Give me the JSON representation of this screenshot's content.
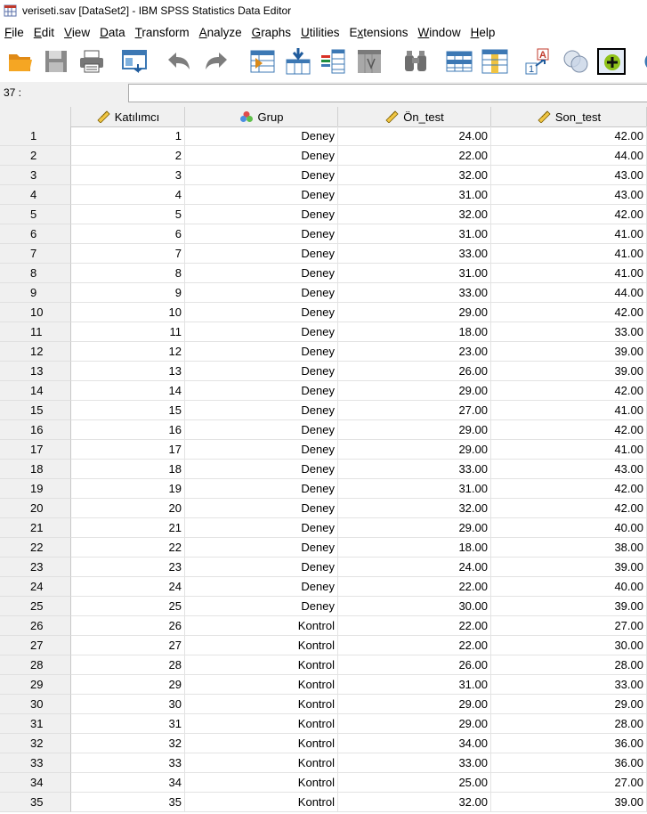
{
  "window": {
    "title": "veriseti.sav [DataSet2] - IBM SPSS Statistics Data Editor"
  },
  "menu": [
    {
      "label": "File",
      "ul": "F",
      "rest": "ile"
    },
    {
      "label": "Edit",
      "ul": "E",
      "rest": "dit"
    },
    {
      "label": "View",
      "ul": "V",
      "rest": "iew"
    },
    {
      "label": "Data",
      "ul": "D",
      "rest": "ata"
    },
    {
      "label": "Transform",
      "ul": "T",
      "rest": "ransform"
    },
    {
      "label": "Analyze",
      "ul": "A",
      "rest": "nalyze"
    },
    {
      "label": "Graphs",
      "ul": "G",
      "rest": "raphs"
    },
    {
      "label": "Utilities",
      "ul": "U",
      "rest": "tilities"
    },
    {
      "label": "Extensions",
      "ul": "x",
      "pre": "E",
      "rest": "tensions"
    },
    {
      "label": "Window",
      "ul": "W",
      "rest": "indow"
    },
    {
      "label": "Help",
      "ul": "H",
      "rest": "elp"
    }
  ],
  "toolbar": {
    "icons": [
      "open-folder-icon",
      "save-icon",
      "print-icon",
      "recall-dialog-icon",
      "undo-icon",
      "redo-icon",
      "goto-case-icon",
      "goto-variable-icon",
      "variables-icon",
      "run-descriptives-icon",
      "find-icon",
      "insert-cases-icon",
      "insert-variable-icon",
      "split-file-icon",
      "weight-cases-icon",
      "select-cases-icon",
      "value-labels-icon",
      "use-sets-icon"
    ]
  },
  "cellbar": {
    "ref": "37 :",
    "value": ""
  },
  "columns": [
    {
      "name": "Katılımcı",
      "icon": "scale-ruler-icon"
    },
    {
      "name": "Grup",
      "icon": "nominal-circles-icon"
    },
    {
      "name": "Ön_test",
      "icon": "scale-ruler-icon"
    },
    {
      "name": "Son_test",
      "icon": "scale-ruler-icon"
    }
  ],
  "rows": [
    [
      "1",
      "1",
      "Deney",
      "24.00",
      "42.00"
    ],
    [
      "2",
      "2",
      "Deney",
      "22.00",
      "44.00"
    ],
    [
      "3",
      "3",
      "Deney",
      "32.00",
      "43.00"
    ],
    [
      "4",
      "4",
      "Deney",
      "31.00",
      "43.00"
    ],
    [
      "5",
      "5",
      "Deney",
      "32.00",
      "42.00"
    ],
    [
      "6",
      "6",
      "Deney",
      "31.00",
      "41.00"
    ],
    [
      "7",
      "7",
      "Deney",
      "33.00",
      "41.00"
    ],
    [
      "8",
      "8",
      "Deney",
      "31.00",
      "41.00"
    ],
    [
      "9",
      "9",
      "Deney",
      "33.00",
      "44.00"
    ],
    [
      "10",
      "10",
      "Deney",
      "29.00",
      "42.00"
    ],
    [
      "11",
      "11",
      "Deney",
      "18.00",
      "33.00"
    ],
    [
      "12",
      "12",
      "Deney",
      "23.00",
      "39.00"
    ],
    [
      "13",
      "13",
      "Deney",
      "26.00",
      "39.00"
    ],
    [
      "14",
      "14",
      "Deney",
      "29.00",
      "42.00"
    ],
    [
      "15",
      "15",
      "Deney",
      "27.00",
      "41.00"
    ],
    [
      "16",
      "16",
      "Deney",
      "29.00",
      "42.00"
    ],
    [
      "17",
      "17",
      "Deney",
      "29.00",
      "41.00"
    ],
    [
      "18",
      "18",
      "Deney",
      "33.00",
      "43.00"
    ],
    [
      "19",
      "19",
      "Deney",
      "31.00",
      "42.00"
    ],
    [
      "20",
      "20",
      "Deney",
      "32.00",
      "42.00"
    ],
    [
      "21",
      "21",
      "Deney",
      "29.00",
      "40.00"
    ],
    [
      "22",
      "22",
      "Deney",
      "18.00",
      "38.00"
    ],
    [
      "23",
      "23",
      "Deney",
      "24.00",
      "39.00"
    ],
    [
      "24",
      "24",
      "Deney",
      "22.00",
      "40.00"
    ],
    [
      "25",
      "25",
      "Deney",
      "30.00",
      "39.00"
    ],
    [
      "26",
      "26",
      "Kontrol",
      "22.00",
      "27.00"
    ],
    [
      "27",
      "27",
      "Kontrol",
      "22.00",
      "30.00"
    ],
    [
      "28",
      "28",
      "Kontrol",
      "26.00",
      "28.00"
    ],
    [
      "29",
      "29",
      "Kontrol",
      "31.00",
      "33.00"
    ],
    [
      "30",
      "30",
      "Kontrol",
      "29.00",
      "29.00"
    ],
    [
      "31",
      "31",
      "Kontrol",
      "29.00",
      "28.00"
    ],
    [
      "32",
      "32",
      "Kontrol",
      "34.00",
      "36.00"
    ],
    [
      "33",
      "33",
      "Kontrol",
      "33.00",
      "36.00"
    ],
    [
      "34",
      "34",
      "Kontrol",
      "25.00",
      "27.00"
    ],
    [
      "35",
      "35",
      "Kontrol",
      "32.00",
      "39.00"
    ]
  ]
}
